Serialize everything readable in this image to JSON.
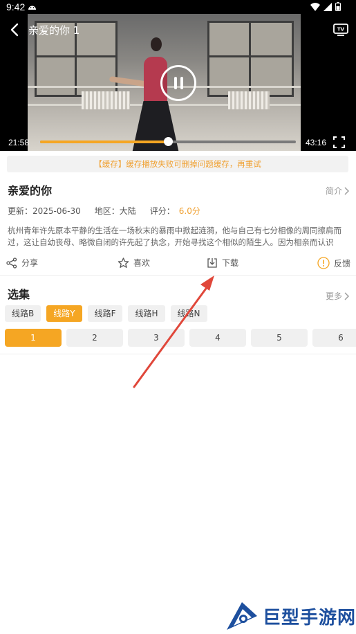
{
  "status_bar": {
    "time": "9:42"
  },
  "video": {
    "title": "亲爱的你 1",
    "current_time": "21:58",
    "duration": "43:16",
    "progress": 0.5
  },
  "notice": "【缓存】缓存播放失败可删掉问题缓存，再重试",
  "show": {
    "title": "亲爱的你",
    "intro_label": "简介",
    "updated": "更新：2025-06-30",
    "region": "地区：大陆",
    "score_label": "评分：",
    "score": "6.0分",
    "description": "杭州青年许先原本平静的生活在一场秋末的暴雨中掀起涟漪，他与自己有七分相像的周同擦肩而过，这让自幼丧母、略微自闭的许先起了执念，开始寻找这个相似的陌生人。因为相亲而认识的…"
  },
  "actions": {
    "share": "分享",
    "like": "喜欢",
    "download": "下载",
    "feedback": "反馈"
  },
  "episodes": {
    "title": "选集",
    "more_label": "更多",
    "lines": [
      "线路B",
      "线路Y",
      "线路F",
      "线路H",
      "线路N"
    ],
    "active_line": 1,
    "items": [
      "1",
      "2",
      "3",
      "4",
      "5",
      "6"
    ],
    "active_item": 0
  },
  "watermark": {
    "text": "巨型手游网"
  },
  "colors": {
    "accent": "#f5a623",
    "arrow": "#e0473a",
    "brand": "#1d4f9e"
  }
}
